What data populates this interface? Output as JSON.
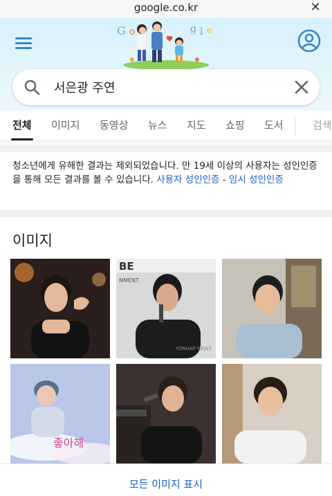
{
  "browser": {
    "url": "google.co.kr",
    "close_icon": "close-icon"
  },
  "header": {
    "menu_icon": "hamburger-icon",
    "account_icon": "account-icon",
    "doodle_letters": "Google"
  },
  "search": {
    "query": "서은광 주연",
    "search_icon": "search-icon",
    "clear_icon": "clear-icon"
  },
  "tabs": [
    {
      "label": "전체",
      "active": true
    },
    {
      "label": "이미지"
    },
    {
      "label": "동영상"
    },
    {
      "label": "뉴스"
    },
    {
      "label": "지도"
    },
    {
      "label": "쇼핑"
    },
    {
      "label": "도서"
    },
    {
      "label": "검색"
    }
  ],
  "notice": {
    "text": "청소년에게 유해한 결과는 제외되었습니다. 만 19세 이상의 사용자는 성인인증을 통해 모든 결과를 볼 수 있습니다.",
    "link1": "사용자 성인인증",
    "dash": " - ",
    "link2": "임시 성인인증"
  },
  "images": {
    "title": "이미지",
    "watermarks": {
      "t2_banner": "BE",
      "t2_sub": "NMENT",
      "t2_mark": "YONHAP NEWS",
      "t4_text": "좋아해"
    },
    "show_all": "모든 이미지 표시"
  },
  "colors": {
    "accent": "#3b86c4",
    "link": "#1a5fc8",
    "header_bg": "#d8f1fb"
  }
}
